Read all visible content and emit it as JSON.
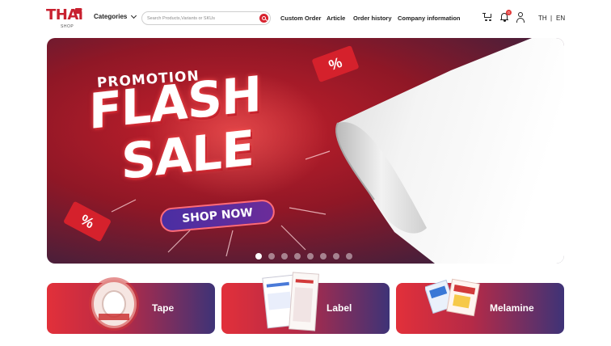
{
  "header": {
    "logo": {
      "main": "THAi",
      "sub": "SHOP"
    },
    "categories_label": "Categories",
    "search": {
      "placeholder": "Search Products,Variants or SKUs"
    },
    "nav": [
      "Custom Order",
      "Article",
      "Order history",
      "Company information"
    ],
    "notifications_count": "0",
    "languages": [
      "TH",
      "EN"
    ],
    "lang_separator": "|"
  },
  "banner": {
    "promo_label": "PROMOTION",
    "headline_1": "FLASH",
    "headline_2": "SALE",
    "cta_label": "SHOP NOW",
    "ticket_symbol": "%",
    "slides": 8,
    "active_slide": 1
  },
  "categories": [
    {
      "label": "Tape"
    },
    {
      "label": "Label"
    },
    {
      "label": "Melamine"
    }
  ],
  "colors": {
    "brand_red": "#c8202f",
    "card_gradient_start": "#e2303a",
    "card_gradient_end": "#3e3377"
  }
}
